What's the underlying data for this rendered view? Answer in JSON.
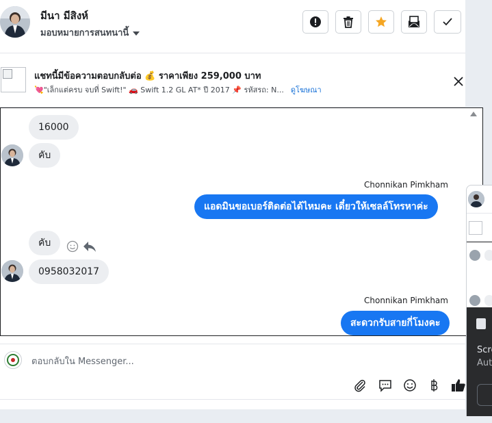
{
  "header": {
    "contact_name": "มีนา มีสิงห์",
    "assign_label": "มอบหมายการสนทนานี้",
    "buttons": [
      {
        "name": "mark-spam-button",
        "icon": "alert-icon"
      },
      {
        "name": "delete-button",
        "icon": "trash-icon"
      },
      {
        "name": "star-button",
        "icon": "star-icon"
      },
      {
        "name": "mark-unread-button",
        "icon": "envelope-icon"
      },
      {
        "name": "mark-done-button",
        "icon": "check-icon"
      }
    ]
  },
  "ad": {
    "title": "แชทนี้มีข้อความตอบกลับต่อ 💰 ราคาเพียง 259,000 บาท",
    "subtitle": "💘\"เล็กแต่ครบ จบที่ Swift!\" 🚗 Swift 1.2 GL AT* ปี 2017 📌 รหัสรถ: N...",
    "link": "ดูโฆษณา"
  },
  "messages": {
    "m1": "16000",
    "m2": "คับ",
    "sender1": "Chonnikan Pimkham",
    "m3": "แอดมินขอเบอร์ติดต่อได้ไหมคะ เดี๋ยวให้เซลล์โทรหาค่ะ",
    "m4": "คับ",
    "m5": "0958032017",
    "sender2": "Chonnikan Pimkham",
    "m6": "สะดวกรับสายกี่โมงคะ"
  },
  "composer": {
    "placeholder": "ตอบกลับใน Messenger..."
  },
  "side_panel": {
    "text1": "Scre",
    "text2": "Aut"
  },
  "colors": {
    "accent": "#1877f2",
    "star": "#f5a623",
    "incoming_bubble": "#eceef1"
  }
}
